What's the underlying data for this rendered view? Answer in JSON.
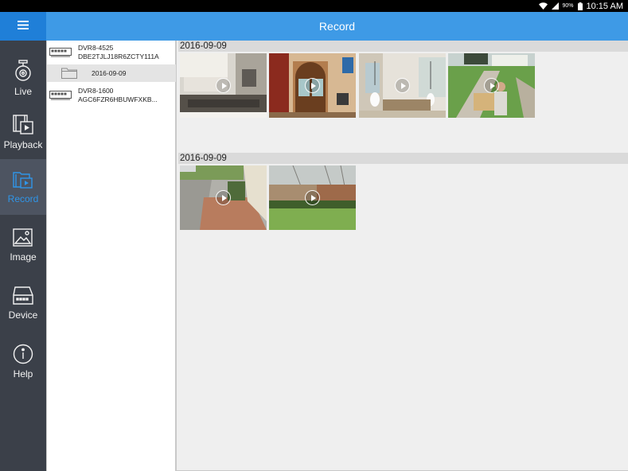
{
  "status_bar": {
    "battery": "90%",
    "time": "10:15 AM"
  },
  "header": {
    "title": "Record"
  },
  "nav": [
    {
      "key": "live",
      "label": "Live",
      "icon": "camera-icon"
    },
    {
      "key": "playback",
      "label": "Playback",
      "icon": "film-icon"
    },
    {
      "key": "record",
      "label": "Record",
      "icon": "record-folder-icon"
    },
    {
      "key": "image",
      "label": "Image",
      "icon": "image-icon"
    },
    {
      "key": "device",
      "label": "Device",
      "icon": "dvr-device-icon"
    },
    {
      "key": "help",
      "label": "Help",
      "icon": "info-icon"
    }
  ],
  "active_nav": "record",
  "tree": {
    "devices": [
      {
        "name": "DVR8-4525",
        "id": "DBE2TJLJ18R6ZCTY111A",
        "folders": [
          "2016-09-09"
        ]
      },
      {
        "name": "DVR8-1600",
        "id": "AGC6FZR6HBUWFXKB..."
      }
    ]
  },
  "groups": [
    {
      "date": "2016-09-09",
      "items": [
        "kitchen",
        "front door",
        "dining room",
        "front yard delivery"
      ]
    },
    {
      "date": "2016-09-09",
      "items": [
        "side walkway",
        "backyard"
      ]
    }
  ],
  "colors": {
    "header": "#3e9ae6",
    "menu": "#1f7fd8",
    "sidebar": "#3b4049",
    "active": "#2f95e8"
  }
}
